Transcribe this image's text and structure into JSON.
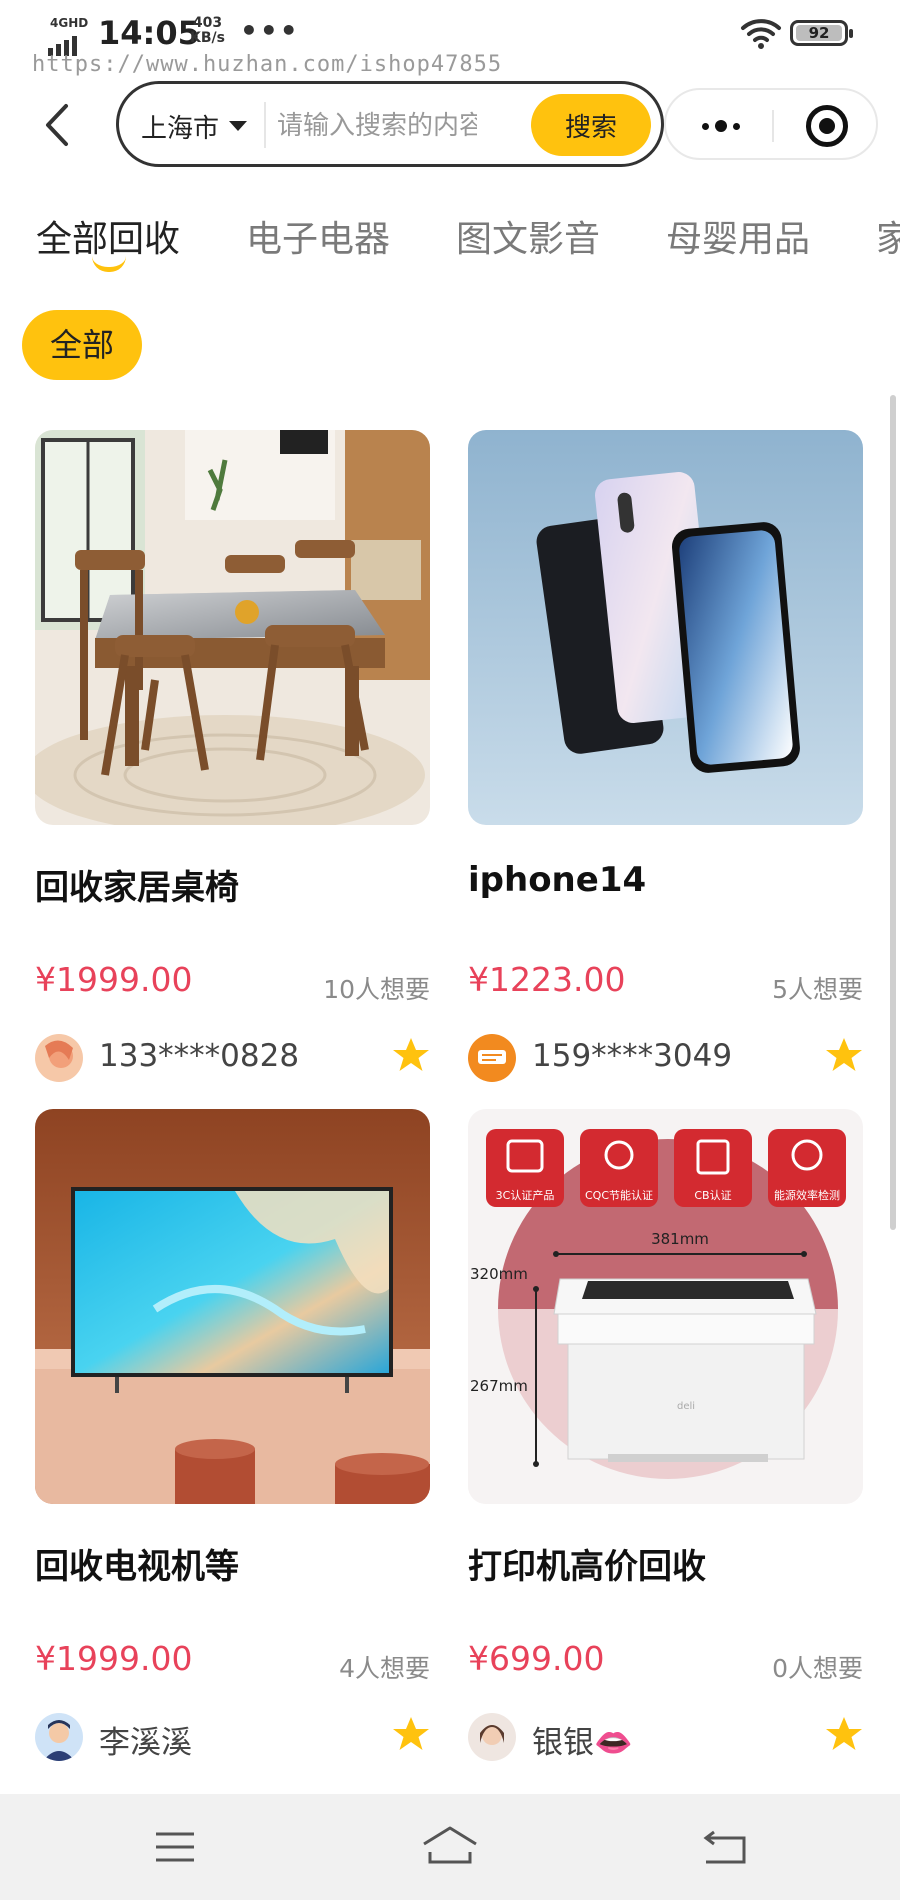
{
  "status_bar": {
    "network": "4GHD",
    "time": "14:05",
    "speed_value": "403",
    "speed_unit": "KB/s",
    "more": "•••",
    "battery": "92"
  },
  "watermark": "https://www.huzhan.com/ishop47855",
  "search": {
    "city": "上海市",
    "placeholder": "请输入搜索的内容",
    "button": "搜索"
  },
  "tabs": [
    "全部回收",
    "电子电器",
    "图文影音",
    "母婴用品",
    "家"
  ],
  "filter_chip": "全部",
  "products": [
    {
      "title": "回收家居桌椅",
      "price": "¥1999.00",
      "wants": "10人想要",
      "user": "133****0828"
    },
    {
      "title": "iphone14",
      "price": "¥1223.00",
      "wants": "5人想要",
      "user": "159****3049"
    },
    {
      "title": "回收电视机等",
      "price": "¥1999.00",
      "wants": "4人想要",
      "user": "李溪溪"
    },
    {
      "title": "打印机高价回收",
      "price": "¥699.00",
      "wants": "0人想要",
      "user": "银银👄"
    }
  ],
  "printer_image": {
    "badges": [
      "3C认证产品",
      "CQC节能认证",
      "CB认证",
      "能源效率检测"
    ],
    "dims": [
      "381mm",
      "320mm",
      "267mm"
    ],
    "brand": "deli"
  },
  "colors": {
    "accent": "#ffc20e",
    "price": "#e8425a",
    "star": "#ffc20e"
  }
}
